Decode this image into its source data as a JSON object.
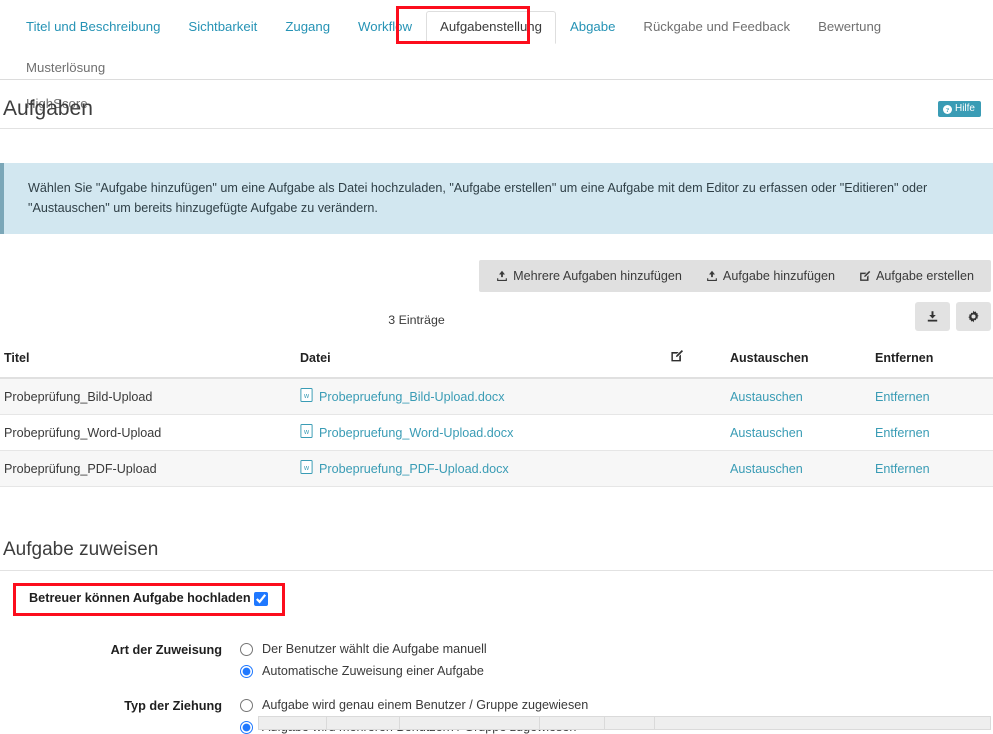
{
  "tabs": {
    "row1": [
      {
        "label": "Titel und Beschreibung",
        "state": "link"
      },
      {
        "label": "Sichtbarkeit",
        "state": "link"
      },
      {
        "label": "Zugang",
        "state": "link"
      },
      {
        "label": "Workflow",
        "state": "link"
      },
      {
        "label": "Aufgabenstellung",
        "state": "active"
      },
      {
        "label": "Abgabe",
        "state": "link"
      },
      {
        "label": "Rückgabe und Feedback",
        "state": "muted"
      },
      {
        "label": "Bewertung",
        "state": "muted"
      },
      {
        "label": "Musterlösung",
        "state": "muted"
      }
    ],
    "row2": [
      {
        "label": "HighScore",
        "state": "muted"
      }
    ]
  },
  "header": {
    "title": "Aufgaben",
    "help_label": "Hilfe"
  },
  "info": {
    "text": "Wählen Sie \"Aufgabe hinzufügen\" um eine Aufgabe als Datei hochzuladen, \"Aufgabe erstellen\" um eine Aufgabe mit dem Editor zu erfassen oder \"Editieren\" oder \"Austauschen\" um bereits hinzugefügte Aufgabe zu verändern."
  },
  "toolbar": {
    "add_multiple_label": "Mehrere Aufgaben hinzufügen",
    "add_single_label": "Aufgabe hinzufügen",
    "create_label": "Aufgabe erstellen"
  },
  "list": {
    "count_label": "3 Einträge",
    "columns": {
      "titel": "Titel",
      "datei": "Datei",
      "edit": "",
      "austauschen": "Austauschen",
      "entfernen": "Entfernen"
    },
    "rows": [
      {
        "titel": "Probeprüfung_Bild-Upload",
        "datei": "Probepruefung_Bild-Upload.docx",
        "austauschen": "Austauschen",
        "entfernen": "Entfernen"
      },
      {
        "titel": "Probeprüfung_Word-Upload",
        "datei": "Probepruefung_Word-Upload.docx",
        "austauschen": "Austauschen",
        "entfernen": "Entfernen"
      },
      {
        "titel": "Probeprüfung_PDF-Upload",
        "datei": "Probepruefung_PDF-Upload.docx",
        "austauschen": "Austauschen",
        "entfernen": "Entfernen"
      }
    ]
  },
  "assign": {
    "section_title": "Aufgabe zuweisen",
    "tutor_upload_label": "Betreuer können Aufgabe hochladen",
    "tutor_upload_checked": true,
    "art": {
      "label": "Art der Zuweisung",
      "options": [
        {
          "label": "Der Benutzer wählt die Aufgabe manuell",
          "selected": false
        },
        {
          "label": "Automatische Zuweisung einer Aufgabe",
          "selected": true
        }
      ]
    },
    "typ": {
      "label": "Typ der Ziehung",
      "options": [
        {
          "label": "Aufgabe wird genau einem Benutzer / Gruppe zugewiesen",
          "selected": false
        },
        {
          "label": "Aufgabe wird mehreren Benutzern / Gruppe zugewiesen",
          "selected": true
        }
      ]
    }
  },
  "icons": {
    "help": "question-circle-icon",
    "upload": "upload-icon",
    "edit": "edit-square-icon",
    "download": "download-icon",
    "settings": "gear-icon",
    "doc": "word-document-icon"
  },
  "colors": {
    "link": "#3a9cb5",
    "tab_link": "#2693b5",
    "highlight": "#fc0d1c",
    "info_bg": "#d2e7f0",
    "info_border": "#7ba7b8",
    "accent_checkbox": "#1f78ff",
    "toolbar_bg": "#e0e0e0",
    "help_badge_bg": "#3a9cb5"
  }
}
